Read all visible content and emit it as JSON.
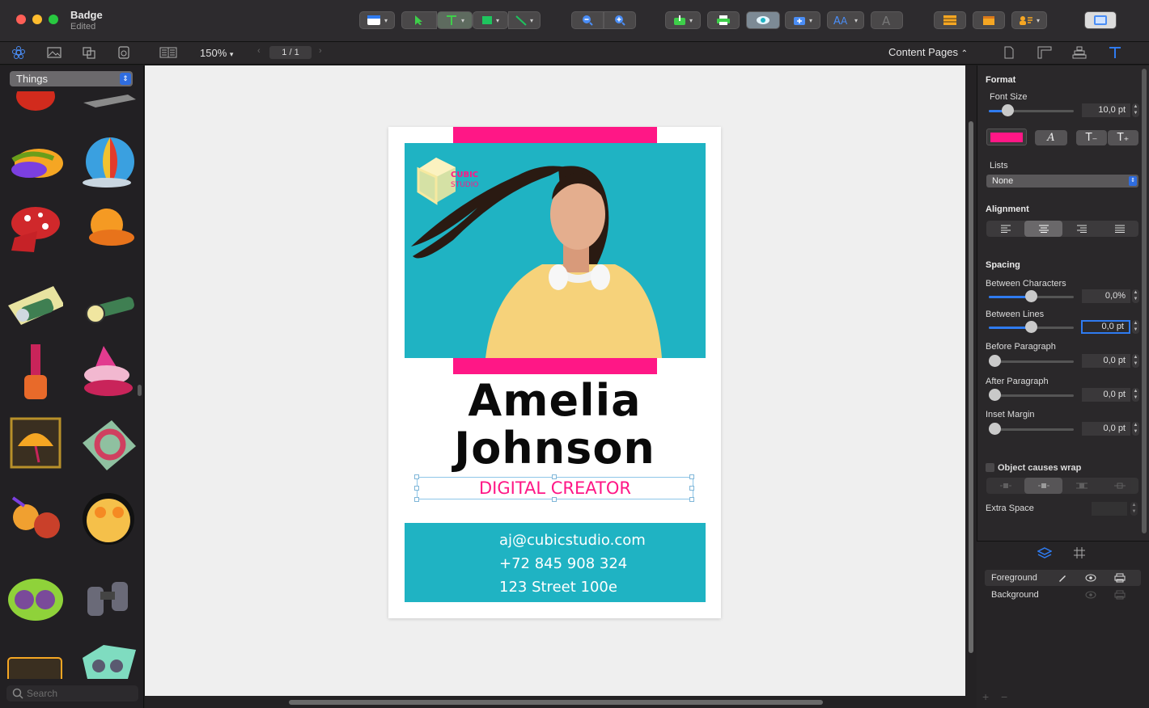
{
  "window": {
    "title": "Badge",
    "subtitle": "Edited"
  },
  "subbar": {
    "zoom": "150%",
    "page_indicator": "1 / 1",
    "view_mode": "Content Pages"
  },
  "library": {
    "category": "Things",
    "search_placeholder": "Search"
  },
  "badge": {
    "logo_line1": "CUBIC",
    "logo_line2": "STUDIO",
    "first_name": "Amelia",
    "last_name": "Johnson",
    "role": "DIGITAL CREATOR",
    "email": "aj@cubicstudio.com",
    "phone": "+72 845 908 324",
    "address": "123 Street 100e"
  },
  "inspector": {
    "format_heading": "Format",
    "font_size_label": "Font Size",
    "font_size_value": "10,0 pt",
    "lists_label": "Lists",
    "lists_value": "None",
    "alignment_heading": "Alignment",
    "spacing_heading": "Spacing",
    "between_chars_label": "Between Characters",
    "between_chars_value": "0,0%",
    "between_lines_label": "Between Lines",
    "between_lines_value": "0,0 pt",
    "before_para_label": "Before Paragraph",
    "before_para_value": "0,0 pt",
    "after_para_label": "After Paragraph",
    "after_para_value": "0,0 pt",
    "inset_margin_label": "Inset Margin",
    "inset_margin_value": "0,0 pt",
    "wrap_label": "Object causes wrap",
    "extra_space_label": "Extra Space",
    "color_accent": "#ff1786"
  },
  "layers": [
    {
      "name": "Foreground"
    },
    {
      "name": "Background"
    }
  ],
  "colors": {
    "brand_pink": "#ff1786",
    "brand_teal": "#1fb3c3",
    "accent_blue": "#2f7bf0"
  }
}
